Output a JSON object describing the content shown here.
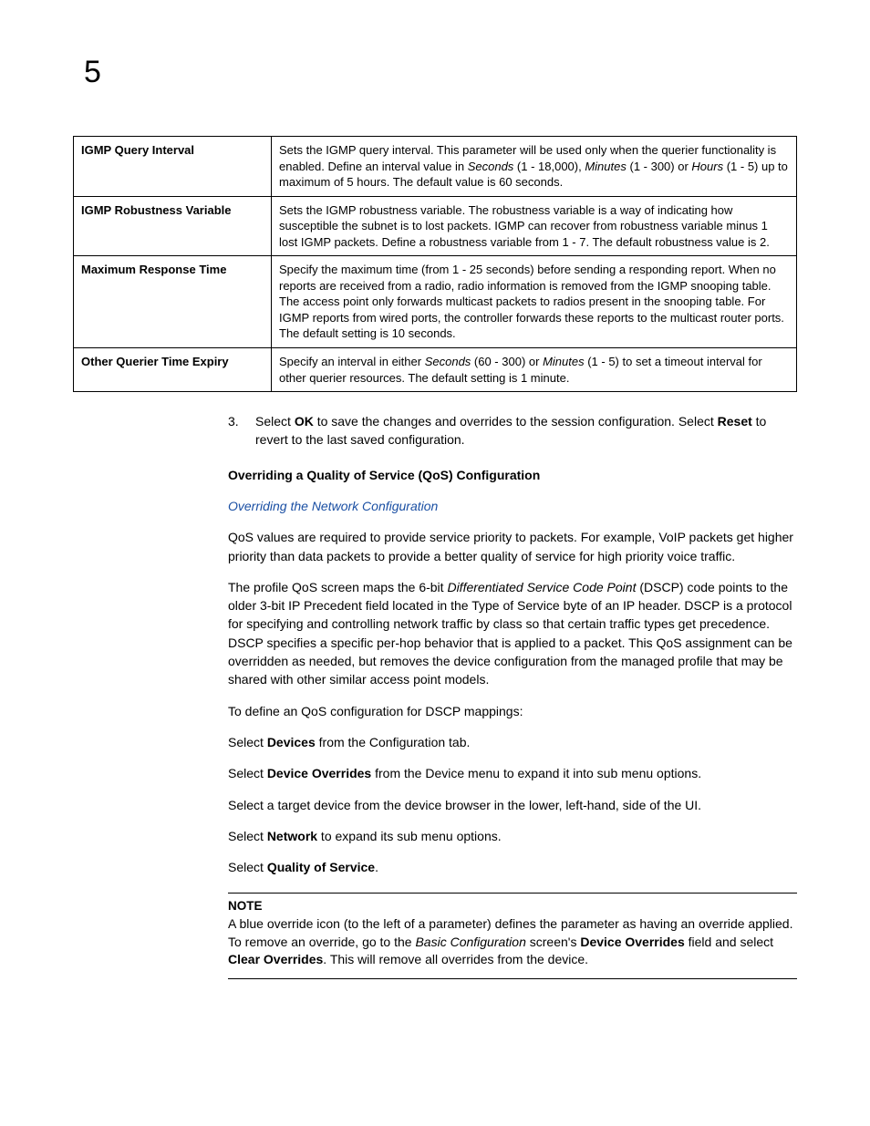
{
  "chapter": "5",
  "table": {
    "rows": [
      {
        "term": "IGMP Query Interval",
        "desc_parts": [
          {
            "t": "Sets the IGMP query interval. This parameter will be used only when the querier functionality is enabled. Define an interval value in "
          },
          {
            "t": "Seconds",
            "i": true
          },
          {
            "t": " (1 - 18,000), "
          },
          {
            "t": "Minutes",
            "i": true
          },
          {
            "t": " (1 - 300) or "
          },
          {
            "t": "Hours",
            "i": true
          },
          {
            "t": " (1 - 5) up to maximum of 5 hours. The default value is 60 seconds."
          }
        ]
      },
      {
        "term": "IGMP Robustness Variable",
        "desc_parts": [
          {
            "t": "Sets the IGMP robustness variable. The robustness variable is a way of indicating how susceptible the subnet is to lost packets. IGMP can recover from robustness variable minus 1 lost IGMP packets. Define a robustness variable from 1 - 7. The default robustness value is 2."
          }
        ]
      },
      {
        "term": "Maximum Response Time",
        "desc_parts": [
          {
            "t": "Specify the maximum time (from 1 - 25 seconds) before sending a responding report. When no reports are received from a radio, radio information is removed from the IGMP snooping table. The access point only forwards multicast packets to radios present in the snooping table. For IGMP reports from wired ports, the controller forwards these reports to the multicast router ports. The default setting is 10 seconds."
          }
        ]
      },
      {
        "term": "Other Querier Time Expiry",
        "desc_parts": [
          {
            "t": "Specify an interval in either "
          },
          {
            "t": "Seconds",
            "i": true
          },
          {
            "t": " (60 - 300) or "
          },
          {
            "t": "Minutes",
            "i": true
          },
          {
            "t": " (1 - 5) to set a timeout interval for other querier resources. The default setting is 1 minute."
          }
        ]
      }
    ]
  },
  "step3": {
    "num": "3.",
    "pre": "Select ",
    "ok": "OK",
    "mid": " to save the changes and overrides to the session configuration. Select ",
    "reset": "Reset",
    "post": " to revert to the last saved configuration."
  },
  "heading_qos": "Overriding a Quality of Service (QoS) Configuration",
  "link_text": "Overriding the Network Configuration",
  "para_qos_intro": "QoS values are required to provide service priority to packets. For example, VoIP packets get higher priority than data packets to provide a better quality of service for high priority voice traffic.",
  "para_dscp": {
    "p1": "The profile QoS screen maps the 6-bit ",
    "i1": "Differentiated Service Code Point",
    "p2": " (DSCP) code points to the older 3-bit IP Precedent field located in the Type of Service byte of an IP header. DSCP is a protocol for specifying and controlling network traffic by class so that certain traffic types get precedence. DSCP specifies a specific per-hop behavior that is applied to a packet. This QoS assignment can be overridden as needed, but removes the device configuration from the managed profile that may be shared with other similar access point models."
  },
  "para_define": "To define an QoS configuration for DSCP mappings:",
  "sel_devices": {
    "pre": "Select ",
    "b": "Devices",
    "post": " from the Configuration tab."
  },
  "sel_overrides": {
    "pre": "Select ",
    "b": "Device Overrides",
    "post": " from the Device menu to expand it into sub menu options."
  },
  "sel_target": "Select a target device from the device browser in the lower, left-hand, side of the UI.",
  "sel_network": {
    "pre": "Select ",
    "b": "Network",
    "post": " to expand its sub menu options."
  },
  "sel_qos": {
    "pre": "Select ",
    "b": "Quality of Service",
    "post": "."
  },
  "note": {
    "label": "NOTE",
    "p1": "A blue override icon (to the left of a parameter) defines the parameter as having an override applied. To remove an override, go to the ",
    "i1": "Basic Configuration",
    "p2": " screen's ",
    "b1": "Device Overrides",
    "p3": " field and select ",
    "b2": "Clear Overrides",
    "p4": ". This will remove all overrides from the device."
  }
}
